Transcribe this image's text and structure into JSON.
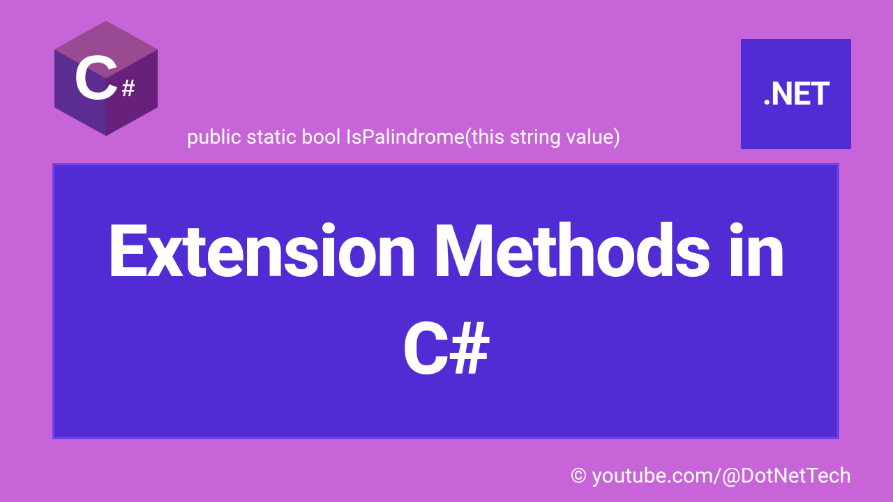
{
  "logo": {
    "csharp_letter": "C",
    "csharp_hash": "#",
    "dotnet_text": ".NET"
  },
  "code_snippet": "public static bool IsPalindrome(this string value)",
  "title": "Extension Methods in C#",
  "credit": "© youtube.com/@DotNetTech",
  "colors": {
    "background": "#c764d8",
    "accent": "#512bd4",
    "csharp_dark": "#68217a",
    "csharp_light": "#9a4993"
  }
}
